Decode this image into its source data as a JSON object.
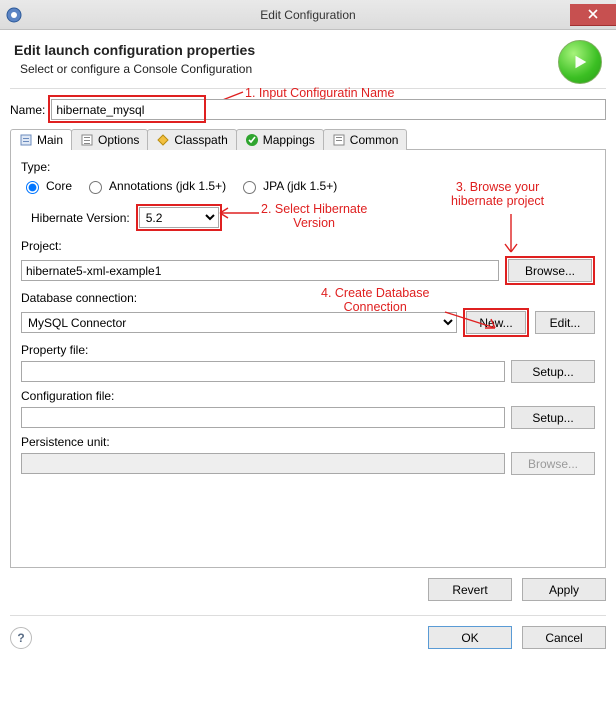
{
  "window": {
    "title": "Edit Configuration"
  },
  "header": {
    "title": "Edit launch configuration properties",
    "subtitle": "Select or configure a Console Configuration"
  },
  "form": {
    "name_label": "Name:",
    "name_value": "hibernate_mysql"
  },
  "tabs": {
    "main": "Main",
    "options": "Options",
    "classpath": "Classpath",
    "mappings": "Mappings",
    "common": "Common"
  },
  "main": {
    "type_label": "Type:",
    "radios": {
      "core": "Core",
      "annotations": "Annotations (jdk 1.5+)",
      "jpa": "JPA (jdk 1.5+)"
    },
    "hibernate_version_label": "Hibernate Version:",
    "hibernate_version_value": "5.2",
    "project_label": "Project:",
    "project_value": "hibernate5-xml-example1",
    "browse": "Browse...",
    "db_conn_label": "Database connection:",
    "db_conn_value": "MySQL Connector",
    "new": "New...",
    "edit": "Edit...",
    "property_file_label": "Property file:",
    "setup": "Setup...",
    "config_file_label": "Configuration file:",
    "persistence_unit_label": "Persistence unit:"
  },
  "annotations": {
    "a1": "1. Input Configuratin Name",
    "a2": "2. Select Hibernate\nVersion",
    "a3": "3. Browse your\nhibernate project",
    "a4": "4. Create Database\nConnection"
  },
  "buttons": {
    "revert": "Revert",
    "apply": "Apply",
    "ok": "OK",
    "cancel": "Cancel"
  }
}
